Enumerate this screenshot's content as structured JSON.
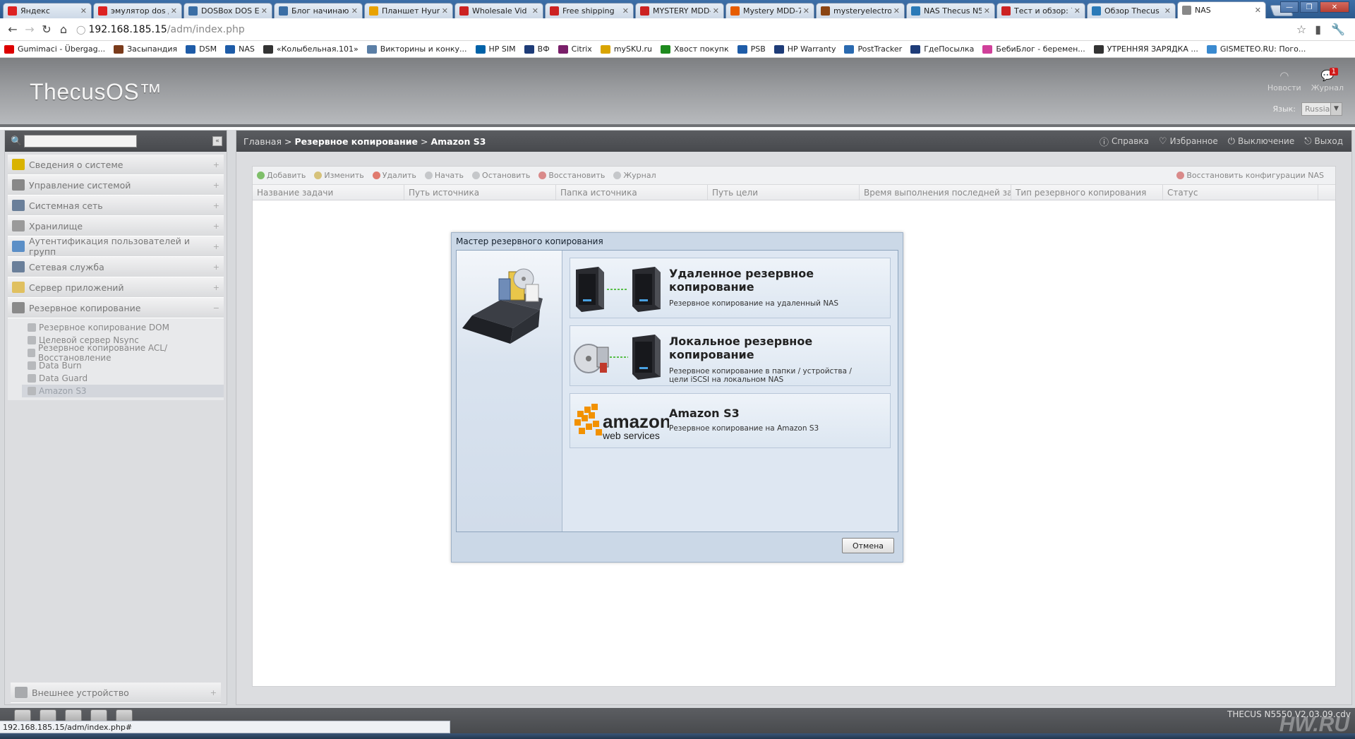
{
  "browser": {
    "tabs": [
      {
        "label": "Яндекс",
        "color": "#d22"
      },
      {
        "label": "эмулятор dos д",
        "color": "#d22"
      },
      {
        "label": "DOSBox DOS E",
        "color": "#3a6ea5"
      },
      {
        "label": "Блог начинаю",
        "color": "#3a6ea5"
      },
      {
        "label": "Планшет Hyun",
        "color": "#e8a200"
      },
      {
        "label": "Wholesale Vid",
        "color": "#c22"
      },
      {
        "label": "Free shipping",
        "color": "#c22"
      },
      {
        "label": "MYSTERY MDD-",
        "color": "#c22"
      },
      {
        "label": "Mystery MDD-7",
        "color": "#e65c00"
      },
      {
        "label": "mysteryelectror",
        "color": "#8b4513"
      },
      {
        "label": "NAS Thecus N5",
        "color": "#2a7ab8"
      },
      {
        "label": "Тест и обзор: 7",
        "color": "#c22"
      },
      {
        "label": "Обзор Thecus",
        "color": "#2a7ab8"
      },
      {
        "label": "NAS",
        "color": "#888"
      }
    ],
    "url_host": "192.168.185.15",
    "url_path": "/adm/index.php",
    "bookmarks": [
      {
        "label": "Gumimaci - Übergag...",
        "color": "#d00"
      },
      {
        "label": "Засыпандия",
        "color": "#7a3b1b"
      },
      {
        "label": "DSM",
        "color": "#1e5ca8"
      },
      {
        "label": "NAS",
        "color": "#1e5ca8"
      },
      {
        "label": "«Колыбельная.101»",
        "color": "#333"
      },
      {
        "label": "Викторины и конку...",
        "color": "#5b7fa6"
      },
      {
        "label": "HP SIM",
        "color": "#0062a8"
      },
      {
        "label": "ВФ",
        "color": "#1e3c78"
      },
      {
        "label": "Citrix",
        "color": "#7a1f6a"
      },
      {
        "label": "mySKU.ru",
        "color": "#d9a400"
      },
      {
        "label": "Хвост покупк",
        "color": "#1e8a1e"
      },
      {
        "label": "PSB",
        "color": "#1e5ca8"
      },
      {
        "label": "HP Warranty",
        "color": "#1e3c78"
      },
      {
        "label": "PostTracker",
        "color": "#2a6ab0"
      },
      {
        "label": "ГдеПосылка",
        "color": "#1e3c78"
      },
      {
        "label": "БебиБлог - беремен...",
        "color": "#d0409a"
      },
      {
        "label": "УТРЕННЯЯ ЗАРЯДКА ...",
        "color": "#333"
      },
      {
        "label": "GISMETEO.RU: Пого...",
        "color": "#3a8ad0"
      }
    ],
    "status_url": "192.168.185.15/adm/index.php#"
  },
  "header": {
    "logo": "ThecusOS™",
    "news_label": "Новости",
    "journal_label": "Журнал",
    "journal_badge": "1",
    "lang_label": "Язык:",
    "lang_value": "Russia"
  },
  "sidebar": {
    "items": [
      {
        "label": "Сведения о системе",
        "color": "#d9b300"
      },
      {
        "label": "Управление системой",
        "color": "#888"
      },
      {
        "label": "Системная сеть",
        "color": "#6a7f9a"
      },
      {
        "label": "Хранилище",
        "color": "#9a9a9a"
      },
      {
        "label": "Аутентификация пользователей и групп",
        "color": "#5b8fc7"
      },
      {
        "label": "Сетевая служба",
        "color": "#6a7f9a"
      },
      {
        "label": "Сервер приложений",
        "color": "#e0c060"
      },
      {
        "label": "Резервное копирование",
        "color": "#8a8a8a"
      }
    ],
    "sub_items": [
      "Резервное копирование DOM",
      "Целевой сервер Nsync",
      "Резервное копирование ACL/Восстановление",
      "Data Burn",
      "Data Guard",
      "Amazon S3"
    ],
    "bottom_item": "Внешнее устройство"
  },
  "breadcrumb": {
    "home": "Главная",
    "section": "Резервное копирование",
    "page": "Amazon S3"
  },
  "head_actions": {
    "help": "Справка",
    "favorites": "Избранное",
    "shutdown": "Выключение",
    "logout": "Выход"
  },
  "actions": {
    "add": "Добавить",
    "edit": "Изменить",
    "delete": "Удалить",
    "start": "Начать",
    "stop": "Остановить",
    "restore": "Восстановить",
    "log": "Журнал",
    "restore_nas": "Восстановить конфигурации NAS"
  },
  "columns": [
    "Название задачи",
    "Путь источника",
    "Папка источника",
    "Путь цели",
    "Время выполнения последней за...",
    "Тип резервного копирования",
    "Статус"
  ],
  "wizard": {
    "title": "Мастер резервного копирования",
    "remote_title": "Удаленное резервное копирование",
    "remote_desc": "Резервное копирование на удаленный NAS",
    "local_title": "Локальное резервное копирование",
    "local_desc": "Резервное копирование в папки / устройства / цели iSCSI на локальном NAS",
    "s3_title": "Amazon S3",
    "s3_desc": "Резервное копирование на Amazon S3",
    "aws_logo_main": "amazon",
    "aws_logo_sub": "web services",
    "cancel": "Отмена"
  },
  "footer": {
    "model": "THECUS N5550 V2.03.09.cdv",
    "watermark": "HW.RU"
  }
}
